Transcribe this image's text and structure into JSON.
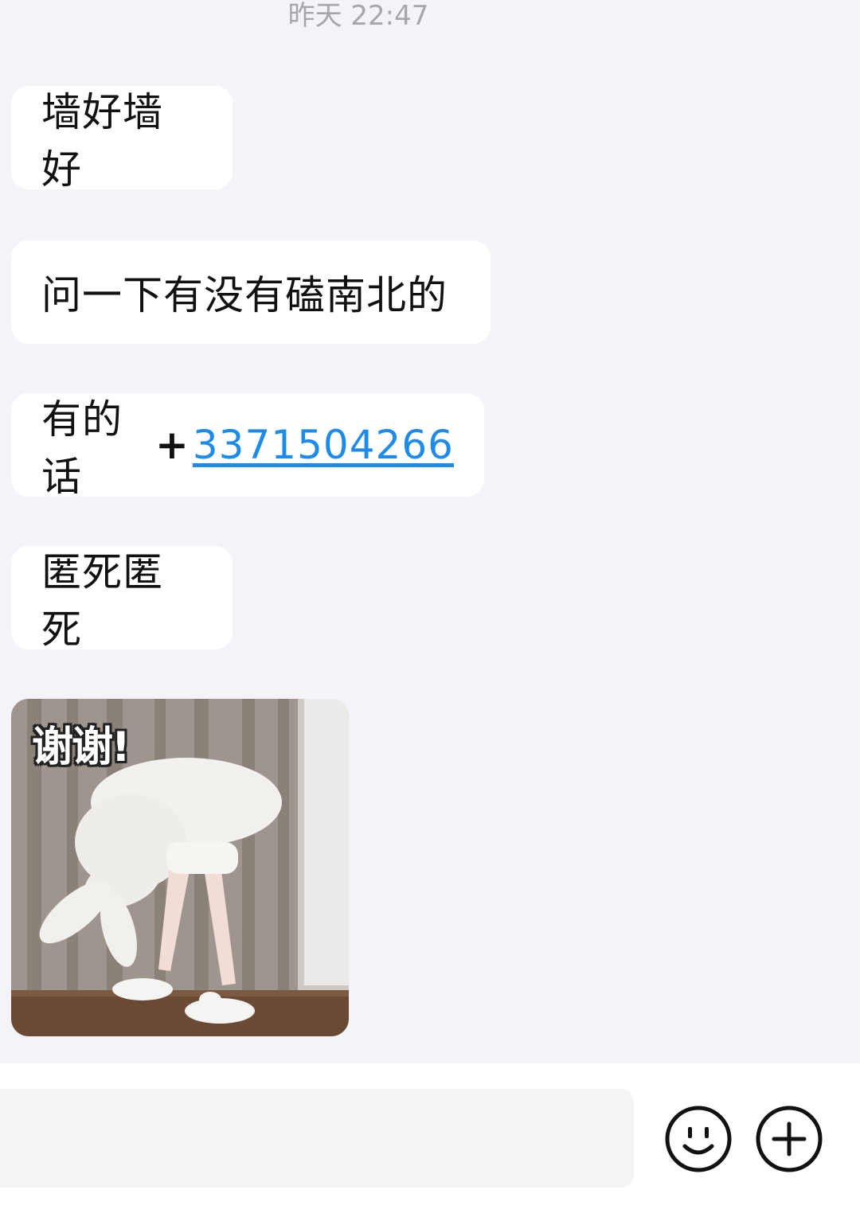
{
  "chat": {
    "timestamp": "昨天 22:47",
    "messages": [
      {
        "text": "墙好墙好"
      },
      {
        "text": "问一下有没有磕南北的"
      },
      {
        "prefix": "有的话",
        "plus": "+",
        "link": "3371504266"
      },
      {
        "text": "匿死匿死"
      }
    ],
    "sticker": {
      "caption": "谢谢!"
    }
  },
  "input_bar": {
    "value": "",
    "placeholder": "",
    "icons": [
      "smiley-face-icon",
      "add-circle-icon"
    ]
  },
  "colors": {
    "background": "#f4f3f7",
    "bubble": "#ffffff",
    "link": "#1f8be8",
    "timestamp": "#a7a6ab"
  }
}
